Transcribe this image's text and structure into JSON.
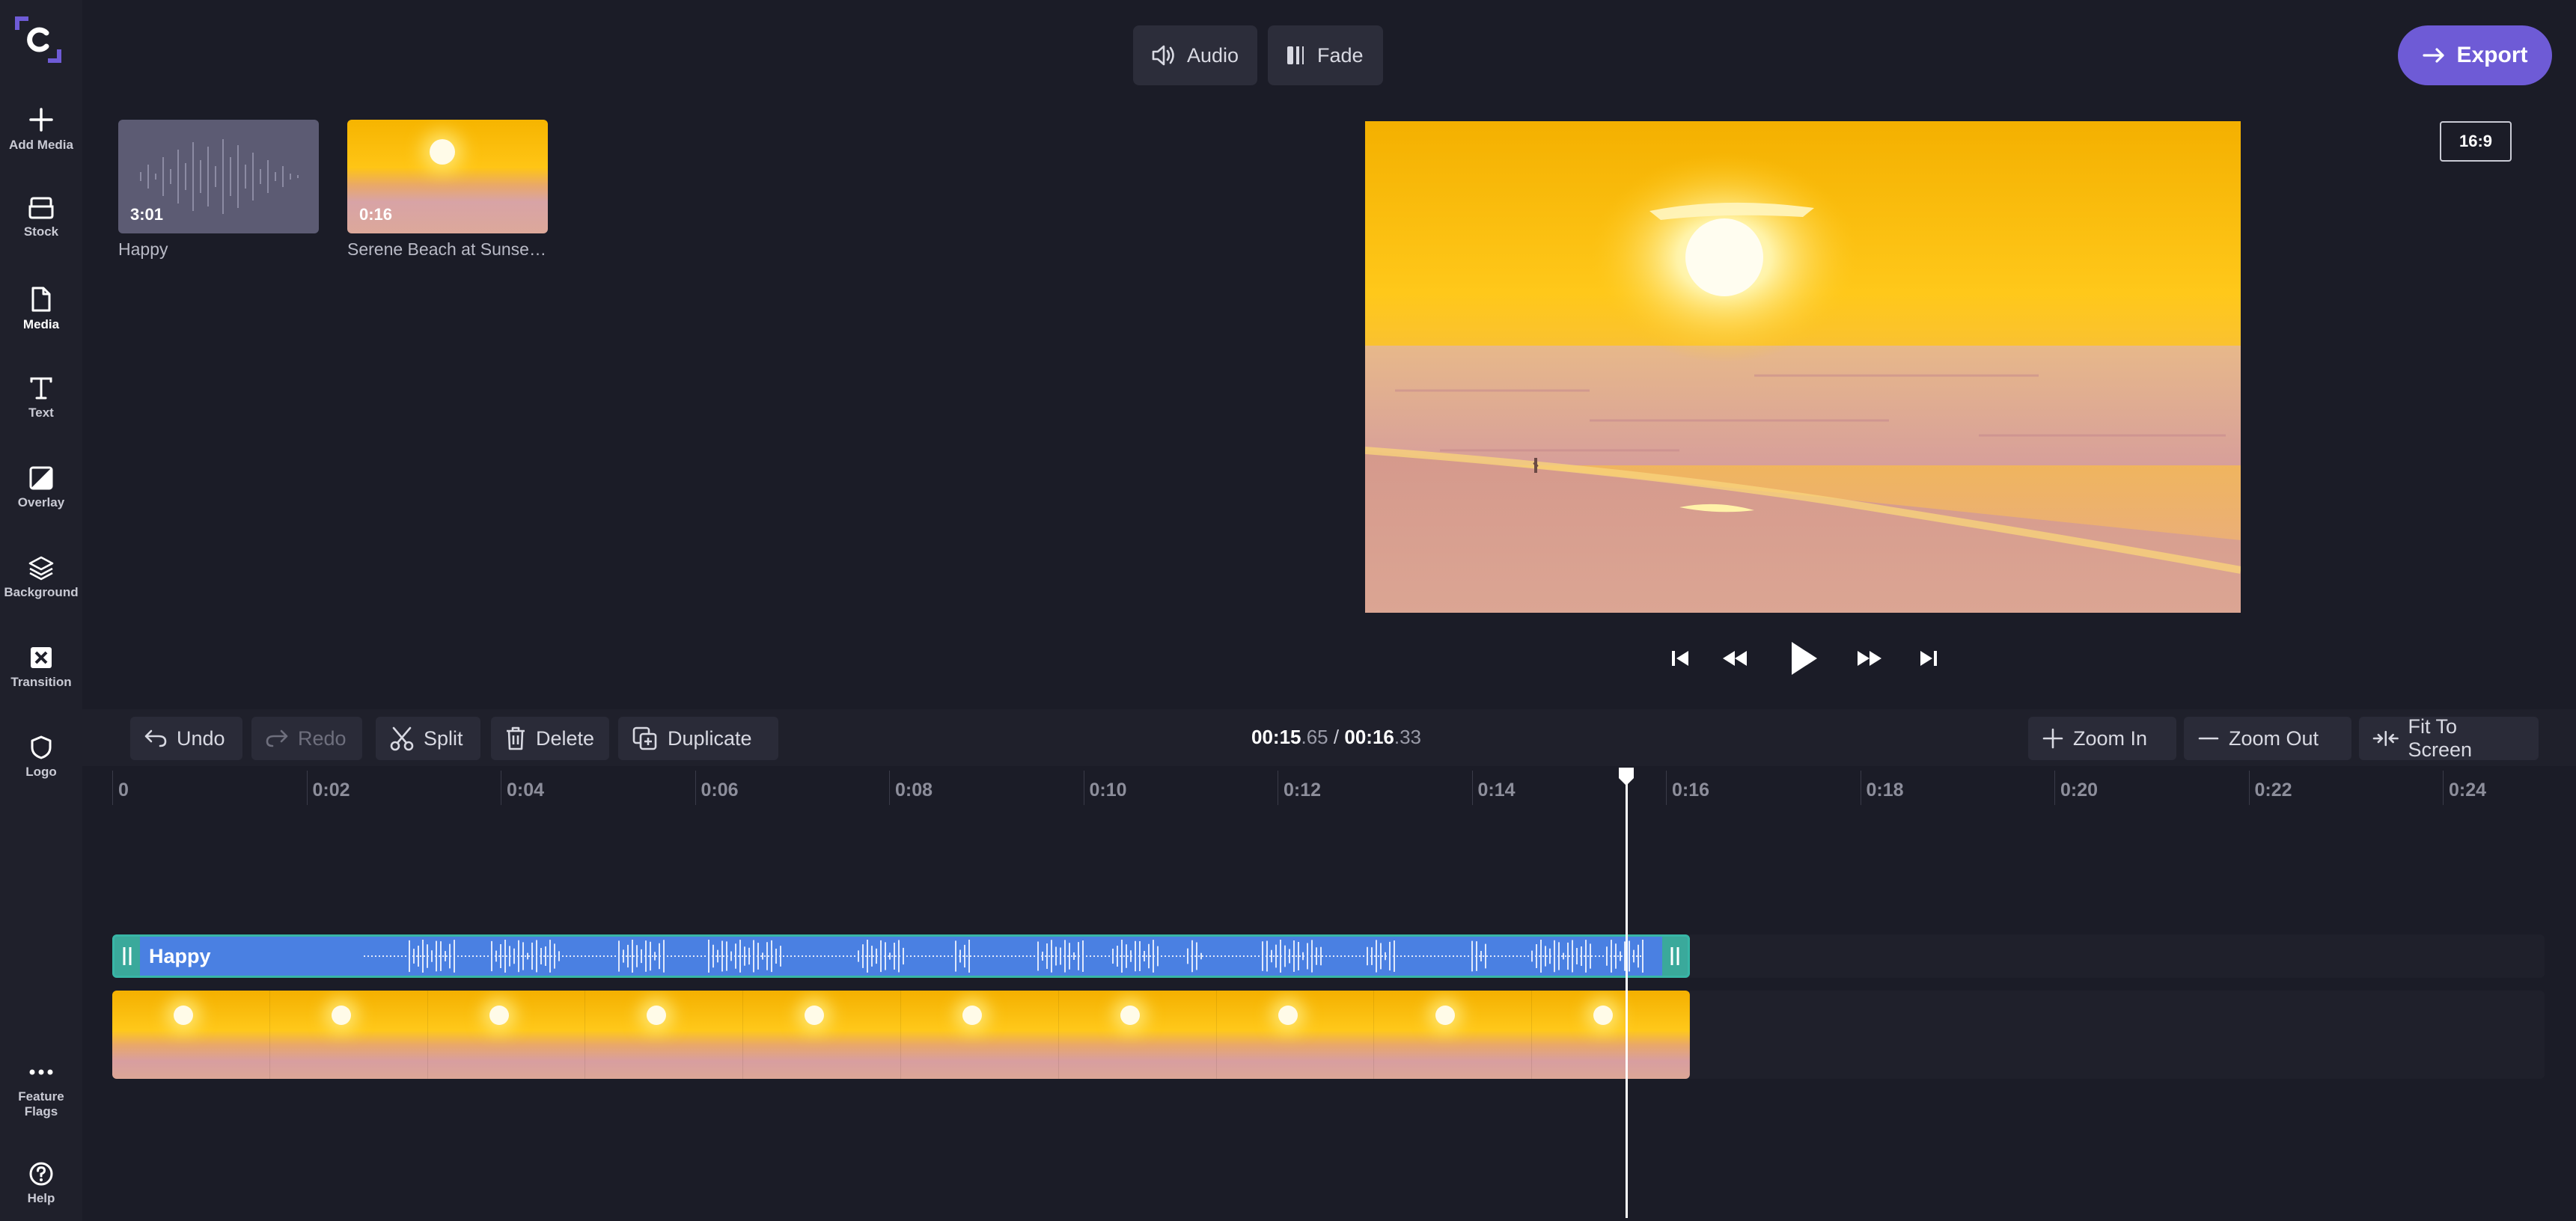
{
  "sidebar": {
    "items": [
      {
        "label": "Add Media",
        "icon": "plus-icon"
      },
      {
        "label": "Stock",
        "icon": "stock-icon"
      },
      {
        "label": "Media",
        "icon": "file-icon"
      },
      {
        "label": "Text",
        "icon": "text-icon"
      },
      {
        "label": "Overlay",
        "icon": "overlay-icon"
      },
      {
        "label": "Background",
        "icon": "layers-icon"
      },
      {
        "label": "Transition",
        "icon": "transition-icon"
      },
      {
        "label": "Logo",
        "icon": "shield-icon"
      }
    ],
    "active": "Media",
    "bottom": [
      {
        "label": "Feature Flags",
        "icon": "more-icon"
      },
      {
        "label": "Help",
        "icon": "help-icon"
      }
    ]
  },
  "toolbar": {
    "audio_label": "Audio",
    "fade_label": "Fade",
    "export_label": "Export"
  },
  "media": {
    "items": [
      {
        "duration": "3:01",
        "label": "Happy"
      },
      {
        "duration": "0:16",
        "label": "Serene Beach at Sunset ..."
      }
    ]
  },
  "preview": {
    "aspect_label": "16:9"
  },
  "edit": {
    "undo_label": "Undo",
    "redo_label": "Redo",
    "split_label": "Split",
    "delete_label": "Delete",
    "duplicate_label": "Duplicate",
    "zoom_in_label": "Zoom In",
    "zoom_out_label": "Zoom Out",
    "fit_label": "Fit To Screen"
  },
  "timecode": {
    "current_main": "00:15",
    "current_frac": ".65",
    "separator": "/",
    "total_main": "00:16",
    "total_frac": ".33"
  },
  "ruler": {
    "ticks": [
      "0",
      "0:02",
      "0:04",
      "0:06",
      "0:08",
      "0:10",
      "0:12",
      "0:14",
      "0:16",
      "0:18",
      "0:20",
      "0:22",
      "0:24"
    ]
  },
  "timeline": {
    "audio_clip_label": "Happy",
    "playhead_time": "00:15.65"
  },
  "colors": {
    "accent": "#6e5bd6",
    "audio_clip": "#4a80e2",
    "audio_handle": "#3aa99b",
    "background": "#1b1c27"
  }
}
